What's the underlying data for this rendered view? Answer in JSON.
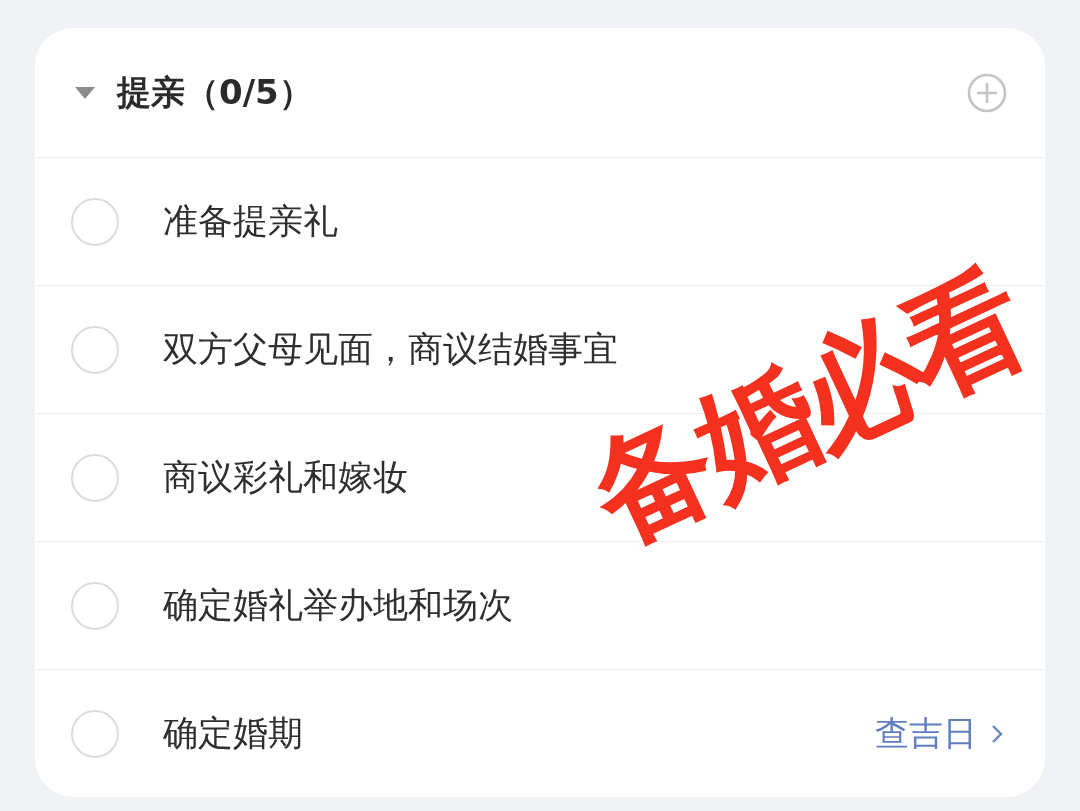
{
  "section": {
    "title": "提亲（0/5）",
    "expanded": true
  },
  "tasks": [
    {
      "label": "准备提亲礼",
      "checked": false
    },
    {
      "label": "双方父母见面，商议结婚事宜",
      "checked": false
    },
    {
      "label": "商议彩礼和嫁妆",
      "checked": false
    },
    {
      "label": "确定婚礼举办地和场次",
      "checked": false
    },
    {
      "label": "确定婚期",
      "checked": false,
      "action": "查吉日"
    }
  ],
  "overlay_caption": "备婚必看"
}
